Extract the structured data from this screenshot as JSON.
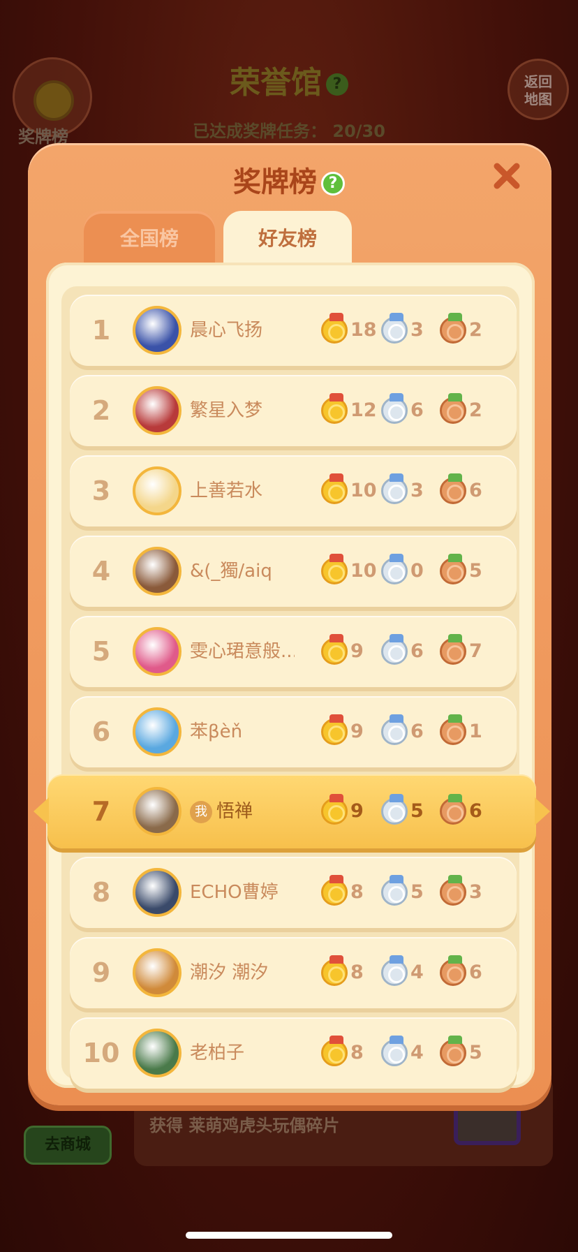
{
  "background": {
    "title": "荣誉馆",
    "progress_label": "已达成奖牌任务：",
    "progress_value": "20/30",
    "medal_button_label": "奖牌榜",
    "back_button_label": "返回\n地图",
    "reward_text": "获得 莱萌鸡虎头玩偶碎片",
    "shop_button_label": "去商城"
  },
  "modal": {
    "title": "奖牌榜",
    "help_icon": "?",
    "tabs": [
      {
        "label": "全国榜",
        "active": false
      },
      {
        "label": "好友榜",
        "active": true
      }
    ]
  },
  "leaderboard": [
    {
      "rank": "1",
      "name": "晨心飞扬",
      "gold": "18",
      "silver": "3",
      "bronze": "2"
    },
    {
      "rank": "2",
      "name": "繁星入梦",
      "gold": "12",
      "silver": "6",
      "bronze": "2"
    },
    {
      "rank": "3",
      "name": "上善若水",
      "gold": "10",
      "silver": "3",
      "bronze": "6"
    },
    {
      "rank": "4",
      "name": "&(_獨/aiq",
      "gold": "10",
      "silver": "0",
      "bronze": "5"
    },
    {
      "rank": "5",
      "name": "雯心珺意般...",
      "gold": "9",
      "silver": "6",
      "bronze": "7"
    },
    {
      "rank": "6",
      "name": "苯βèň",
      "gold": "9",
      "silver": "6",
      "bronze": "1"
    },
    {
      "rank": "7",
      "name": "悟禅",
      "gold": "9",
      "silver": "5",
      "bronze": "6",
      "me_badge": "我"
    },
    {
      "rank": "8",
      "name": "ECHO曹婷",
      "gold": "8",
      "silver": "5",
      "bronze": "3"
    },
    {
      "rank": "9",
      "name": "潮汐 潮汐",
      "gold": "8",
      "silver": "4",
      "bronze": "6"
    },
    {
      "rank": "10",
      "name": "老柏子",
      "gold": "8",
      "silver": "4",
      "bronze": "5"
    }
  ],
  "colors": {
    "gold_medal": "#f7c52c",
    "silver_medal": "#dde6ee",
    "bronze_medal": "#e79a62",
    "self_row": "#f7c04c"
  }
}
